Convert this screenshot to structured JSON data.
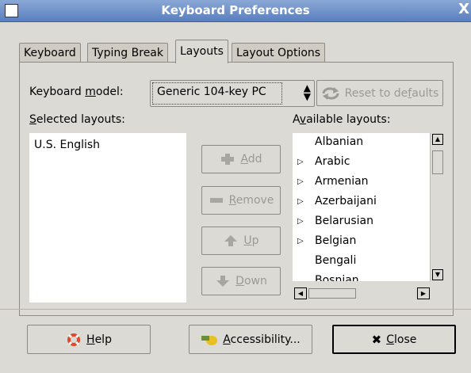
{
  "window": {
    "title": "Keyboard Preferences",
    "close_glyph": "X"
  },
  "tabs": [
    {
      "label": "Keyboard"
    },
    {
      "label": "Typing Break"
    },
    {
      "label": "Layouts"
    },
    {
      "label": "Layout Options"
    }
  ],
  "active_tab": "Layouts",
  "model": {
    "label_pre": "Keyboard ",
    "label_u": "m",
    "label_post": "odel:",
    "value": "Generic 104-key PC"
  },
  "reset": {
    "pre": "Reset to de",
    "u": "f",
    "post": "aults"
  },
  "selected": {
    "label_u": "S",
    "label_post": "elected layouts:",
    "items": [
      "U.S. English"
    ]
  },
  "available": {
    "label_pre": "A",
    "label_u": "v",
    "label_post": "ailable layouts:",
    "items": [
      {
        "label": "Albanian",
        "expandable": false
      },
      {
        "label": "Arabic",
        "expandable": true
      },
      {
        "label": "Armenian",
        "expandable": true
      },
      {
        "label": "Azerbaijani",
        "expandable": true
      },
      {
        "label": "Belarusian",
        "expandable": true
      },
      {
        "label": "Belgian",
        "expandable": true
      },
      {
        "label": "Bengali",
        "expandable": false
      },
      {
        "label": "Bosnian",
        "expandable": false
      }
    ]
  },
  "actions": {
    "add": {
      "u": "A",
      "post": "dd"
    },
    "remove": {
      "u": "R",
      "post": "emove"
    },
    "up": {
      "u": "U",
      "post": "p"
    },
    "down": {
      "u": "D",
      "post": "own"
    }
  },
  "bottom": {
    "help": {
      "u": "H",
      "post": "elp"
    },
    "accessibility": {
      "u": "A",
      "post": "ccessibility..."
    },
    "close": {
      "u": "C",
      "post": "lose",
      "glyph": "✖"
    }
  }
}
